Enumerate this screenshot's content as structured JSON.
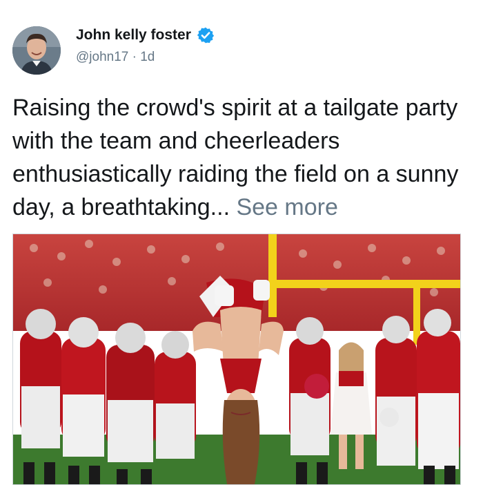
{
  "tweet": {
    "author_name": "John kelly foster",
    "handle": "@john17",
    "separator": "·",
    "age": "1d",
    "text": "Raising the crowd's spirit at a tailgate party with the team and cheerleaders enthusiastically raiding the field on a sunny day, a breathtaking...",
    "see_more": "See more"
  },
  "icons": {
    "verified": "verified-badge-icon",
    "avatar": "profile-photo"
  },
  "colors": {
    "verified_blue": "#1da1f2",
    "secondary_text": "#657786",
    "primary_text": "#14171a",
    "team_red": "#b5121b",
    "field_green": "#3d7a2e",
    "goalpost_yellow": "#f2d21b"
  }
}
